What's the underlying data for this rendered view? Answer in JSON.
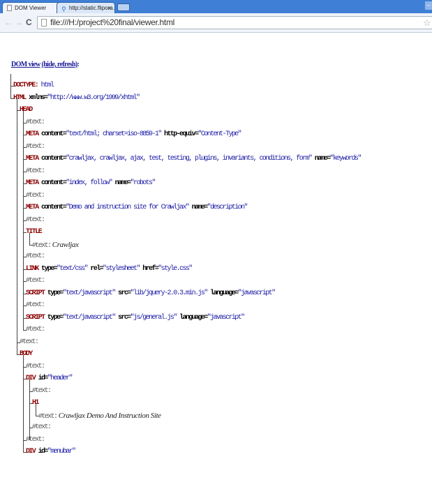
{
  "browser": {
    "tabs": [
      {
        "title": "DOM Viewer",
        "close": "x"
      },
      {
        "title": "http://static.flipora.com/w",
        "close": "x"
      }
    ],
    "url": "file:///H:/project%20final/viewer.html"
  },
  "heading": {
    "title": "DOM view",
    "links": "(hide, refresh)",
    "colon": ":"
  },
  "tree": [
    {
      "tag": "DOCTYPE:",
      "rest": " html",
      "kind": "doctype"
    },
    {
      "tag": "HTML",
      "attrs": [
        {
          "n": " xmlns=",
          "v": "\"http://www.w3.org/1999/xhtml\""
        }
      ]
    },
    {
      "tag": "HEAD"
    },
    {
      "text": "#text:"
    },
    {
      "tag": "META",
      "attrs": [
        {
          "n": " content=",
          "v": "\"text/html; charset=iso-8859-1\""
        },
        {
          "n": " http-equiv=",
          "v": "\"Content-Type\""
        }
      ]
    },
    {
      "text": "#text:"
    },
    {
      "tag": "META",
      "attrs": [
        {
          "n": " content=",
          "v": "\"crawljax, crawljax, ajax, test, testing, plugins, invariants, conditions, form\""
        },
        {
          "n": " name=",
          "v": "\"keywords\""
        }
      ]
    },
    {
      "text": "#text:"
    },
    {
      "tag": "META",
      "attrs": [
        {
          "n": " content=",
          "v": "\"index, follow\""
        },
        {
          "n": " name=",
          "v": "\"robots\""
        }
      ]
    },
    {
      "text": "#text:"
    },
    {
      "tag": "META",
      "attrs": [
        {
          "n": " content=",
          "v": "\"Demo and instruction site for Crawljax\""
        },
        {
          "n": " name=",
          "v": "\"description\""
        }
      ]
    },
    {
      "text": "#text:"
    },
    {
      "tag": "TITLE"
    },
    {
      "text": "#text:",
      "em": " Crawljax"
    },
    {
      "text": "#text:"
    },
    {
      "tag": "LINK",
      "attrs": [
        {
          "n": " type=",
          "v": "\"text/css\""
        },
        {
          "n": " rel=",
          "v": "\"stylesheet\""
        },
        {
          "n": " href=",
          "v": "\"style.css\""
        }
      ]
    },
    {
      "text": "#text:"
    },
    {
      "tag": "SCRIPT",
      "attrs": [
        {
          "n": " type=",
          "v": "\"text/javascript\""
        },
        {
          "n": " src=",
          "v": "\"lib/jquery-2.0.3.min.js\""
        },
        {
          "n": " language=",
          "v": "\"javascript\""
        }
      ]
    },
    {
      "text": "#text:"
    },
    {
      "tag": "SCRIPT",
      "attrs": [
        {
          "n": " type=",
          "v": "\"text/javascript\""
        },
        {
          "n": " src=",
          "v": "\"js/general.js\""
        },
        {
          "n": " language=",
          "v": "\"javascript\""
        }
      ]
    },
    {
      "text": "#text:"
    },
    {
      "text": "#text:"
    },
    {
      "tag": "BODY"
    },
    {
      "text": "#text:"
    },
    {
      "tag": "DIV",
      "attrs": [
        {
          "n": " id=",
          "v": "\"header\""
        }
      ]
    },
    {
      "text": "#text:"
    },
    {
      "tag": "H1"
    },
    {
      "text": "#text:",
      "em": " Crawljax Demo And Instruction Site"
    },
    {
      "text": "#text:"
    },
    {
      "text": "#text:"
    },
    {
      "tag": "DIV",
      "attrs": [
        {
          "n": " id=",
          "v": "\"menubar\""
        }
      ]
    }
  ]
}
